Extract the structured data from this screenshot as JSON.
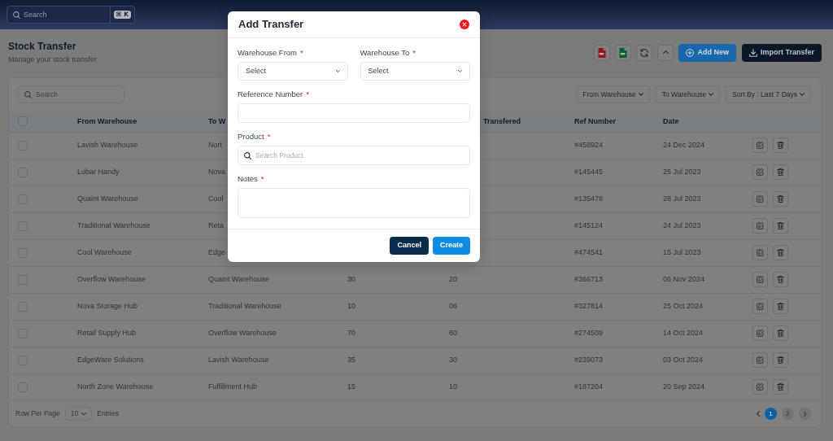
{
  "top_bar": {
    "search": {
      "placeholder": "Search",
      "shortcut": "⌘ K"
    }
  },
  "page_header": {
    "title": "Stock Transfer",
    "subtitle": "Manage your stock transfer",
    "tools": [
      {
        "kind": "pdf"
      },
      {
        "kind": "excel"
      },
      {
        "kind": "refresh"
      },
      {
        "kind": "collapse"
      }
    ],
    "buttons": [
      {
        "kind": "add",
        "label": "Add New"
      },
      {
        "kind": "import",
        "label": "Import Transfer"
      }
    ]
  },
  "table_card": {
    "search": {
      "placeholder": "Search"
    },
    "filters": [
      {
        "label": "From Warehouse"
      },
      {
        "label": "To Warehouse"
      },
      {
        "label": "Sort By : Last 7 Days"
      }
    ],
    "table": {
      "select_all": {
        "checked": false
      },
      "columns": {
        "from_warehouse": "From Warehouse",
        "to_warehouse": "To W",
        "transfered": "Transfered",
        "ref_number": "Ref Number",
        "date": "Date"
      },
      "rows": [
        {
          "checked": false,
          "from_warehouse": "Lavish Warehouse",
          "to_warehouse": "Nort",
          "ref_number": "#458924",
          "date": "24 Dec 2024"
        },
        {
          "checked": false,
          "from_warehouse": "Lobar Handy",
          "to_warehouse": "Nova",
          "ref_number": "#145445",
          "date": "25 Jul 2023"
        },
        {
          "checked": false,
          "from_warehouse": "Quaint Warehouse",
          "to_warehouse": "Cool",
          "ref_number": "#135478",
          "date": "28 Jul 2023"
        },
        {
          "checked": false,
          "from_warehouse": "Traditional Warehouse",
          "to_warehouse": "Reta",
          "ref_number": "#145124",
          "date": "24 Jul 2023"
        },
        {
          "checked": false,
          "from_warehouse": "Cool Warehouse",
          "to_warehouse": "Edge",
          "ref_number": "#474541",
          "date": "15 Jul 2023"
        },
        {
          "checked": false,
          "from_warehouse": "Overflow Warehouse",
          "to_warehouse": "Quaint Warehouse",
          "column_4": "30",
          "transfered": "20",
          "ref_number": "#366713",
          "date": "06 Nov 2024"
        },
        {
          "checked": false,
          "from_warehouse": "Nova Storage Hub",
          "to_warehouse": "Traditional Warehouse",
          "column_4": "10",
          "transfered": "06",
          "ref_number": "#327814",
          "date": "25 Oct 2024"
        },
        {
          "checked": false,
          "from_warehouse": "Retail Supply Hub",
          "to_warehouse": "Overflow Warehouse",
          "column_4": "70",
          "transfered": "60",
          "ref_number": "#274509",
          "date": "14 Oct 2024"
        },
        {
          "checked": false,
          "from_warehouse": "EdgeWare Solutions",
          "to_warehouse": "Lavish Warehouse",
          "column_4": "35",
          "transfered": "30",
          "ref_number": "#239073",
          "date": "03 Oct 2024"
        },
        {
          "checked": false,
          "from_warehouse": "North Zone Warehouse",
          "to_warehouse": "Fulfillment Hub",
          "column_4": "15",
          "transfered": "10",
          "ref_number": "#187204",
          "date": "20 Sep 2024"
        }
      ]
    },
    "footer": {
      "rows_per_page_label": "Row Per Page",
      "page_size": "10",
      "entries_label": "Entries",
      "pages": [
        {
          "label": "1",
          "selected": true
        },
        {
          "label": "2",
          "selected": false
        }
      ]
    }
  },
  "modal": {
    "title": "Add Transfer",
    "fields": [
      {
        "kind": "select",
        "label": "Warehouse From",
        "required_mark": "*",
        "value": "Select"
      },
      {
        "kind": "select",
        "label": "Warehouse To",
        "required_mark": "*",
        "value": "Select"
      },
      {
        "kind": "text",
        "label": "Reference Number",
        "required_mark": "*"
      },
      {
        "kind": "search",
        "label": "Product",
        "required_mark": "*",
        "placeholder": "Search Product"
      },
      {
        "kind": "textarea",
        "label": "Notes",
        "required_mark": "*"
      }
    ],
    "buttons": [
      {
        "kind": "cancel",
        "label": "Cancel"
      },
      {
        "kind": "create",
        "label": "Create"
      }
    ]
  }
}
